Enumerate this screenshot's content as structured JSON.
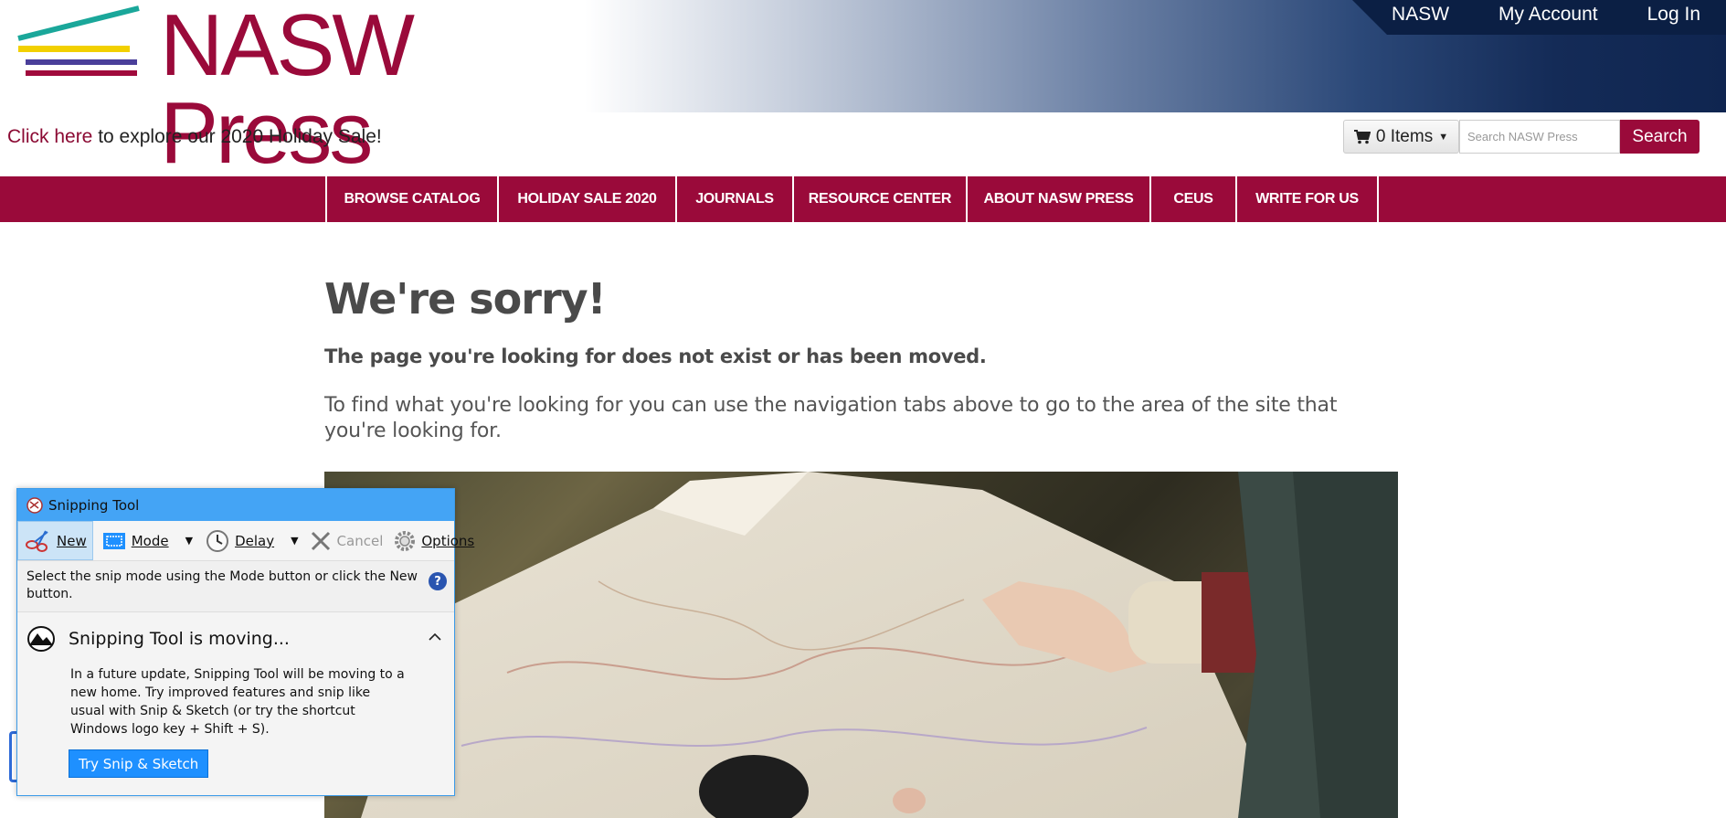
{
  "header": {
    "logo_text": "NASW Press",
    "top_links": [
      "NASW",
      "My Account",
      "Log In"
    ]
  },
  "promo": {
    "link_text": "Click here",
    "rest_text": " to explore our 2020 Holiday Sale!"
  },
  "cart": {
    "label": "0 Items"
  },
  "search": {
    "placeholder": "Search NASW Press",
    "button_label": "Search"
  },
  "nav": {
    "items": [
      "BROWSE CATALOG",
      "HOLIDAY SALE 2020",
      "JOURNALS",
      "RESOURCE CENTER",
      "ABOUT NASW PRESS",
      "CEUS",
      "WRITE FOR US"
    ]
  },
  "main": {
    "heading": "We're sorry!",
    "subheading": "The page you're looking for does not exist or has been moved.",
    "paragraph": "To find what you're looking for you can use the navigation tabs above to go to the area of the site that you're looking for."
  },
  "snipping_tool": {
    "title": "Snipping Tool",
    "toolbar": {
      "new": "New",
      "mode": "Mode",
      "delay": "Delay",
      "cancel": "Cancel",
      "options": "Options"
    },
    "info": "Select the snip mode using the Mode button or click the New button.",
    "help": "?",
    "panel_title": "Snipping Tool is moving...",
    "panel_body": "In a future update, Snipping Tool will be moving to a new home. Try improved features and snip like usual with Snip & Sketch (or try the shortcut Windows logo key + Shift + S).",
    "try_button": "Try Snip & Sketch"
  },
  "colors": {
    "brand_maroon": "#9a0a3a",
    "navy": "#0f2550",
    "snip_blue": "#44a4f5"
  }
}
